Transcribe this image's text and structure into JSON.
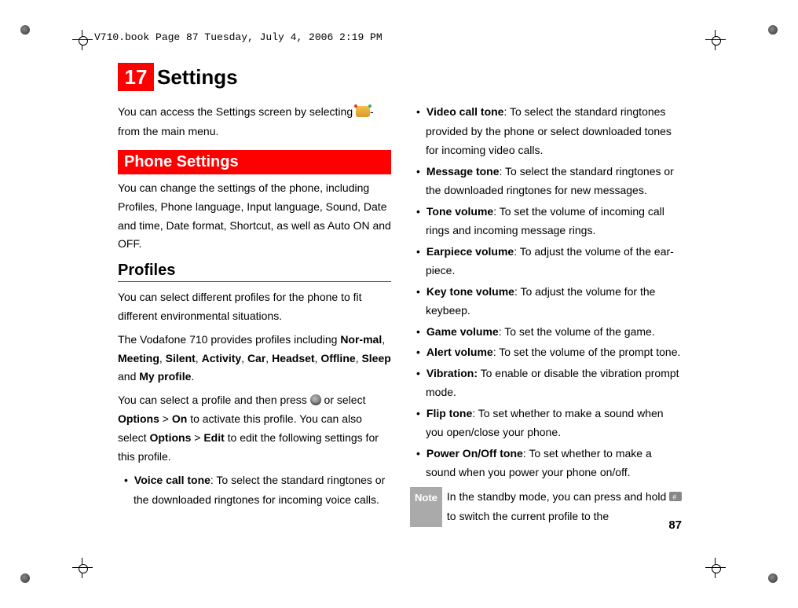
{
  "header_meta": "V710.book  Page 87  Tuesday, July 4, 2006  2:19 PM",
  "chapter": {
    "num": "17",
    "title": "Settings"
  },
  "intro": {
    "p1a": "You can access the Settings screen by selecting",
    "p1b": "-from the main menu."
  },
  "section1": {
    "bar": "Phone Settings",
    "p1": "You can change the settings of the phone, including Profiles, Phone language, Input language, Sound, Date and time, Date format, Shortcut, as well as Auto ON and OFF."
  },
  "profiles": {
    "heading": "Profiles",
    "p1": "You can select different profiles for the phone to fit different environmental situations.",
    "p2_pre": "The Vodafone 710 provides profiles including ",
    "p2_items": [
      "Nor-mal",
      "Meeting",
      "Silent",
      "Activity",
      "Car",
      "Headset",
      "Offline",
      "Sleep",
      "My profile"
    ],
    "p2_post": ".",
    "p3a": "You can select a profile and then press ",
    "p3b": " or select ",
    "p3c1": "Options",
    "p3c2": " > ",
    "p3c3": "On",
    "p3d": " to activate this profile. You can also select ",
    "p3e1": "Options",
    "p3e2": " > ",
    "p3e3": "Edit",
    "p3f": " to edit the following settings for this profile."
  },
  "bullets": [
    {
      "b": "Voice call tone",
      "t": ": To select the standard ringtones or the downloaded ringtones for incoming voice calls."
    },
    {
      "b": "Video call tone",
      "t": ": To select the standard ringtones provided by the phone or select downloaded tones for incoming video calls."
    },
    {
      "b": "Message tone",
      "t": ": To select the standard ringtones or the downloaded ringtones for new messages."
    },
    {
      "b": "Tone volume",
      "t": ": To set the volume of incoming call rings and incoming message rings."
    },
    {
      "b": "Earpiece volume",
      "t": ": To adjust the volume of the ear-piece."
    },
    {
      "b": "Key tone volume",
      "t": ": To adjust the volume for the keybeep."
    },
    {
      "b": "Game volume",
      "t": ": To set the volume of the game."
    },
    {
      "b": "Alert volume",
      "t": ": To set the volume of the prompt tone."
    },
    {
      "b": "Vibration:",
      "t": " To enable or disable the vibration prompt mode."
    },
    {
      "b": "Flip tone",
      "t": ": To set whether to make a sound when you open/close your phone."
    },
    {
      "b": "Power On/Off tone",
      "t": ": To set whether to make a sound when you power your phone on/off."
    }
  ],
  "note": {
    "label": "Note",
    "text_a": "In the standby mode, you can press and hold ",
    "text_b": " to switch the current profile to the"
  },
  "page_num": "87"
}
